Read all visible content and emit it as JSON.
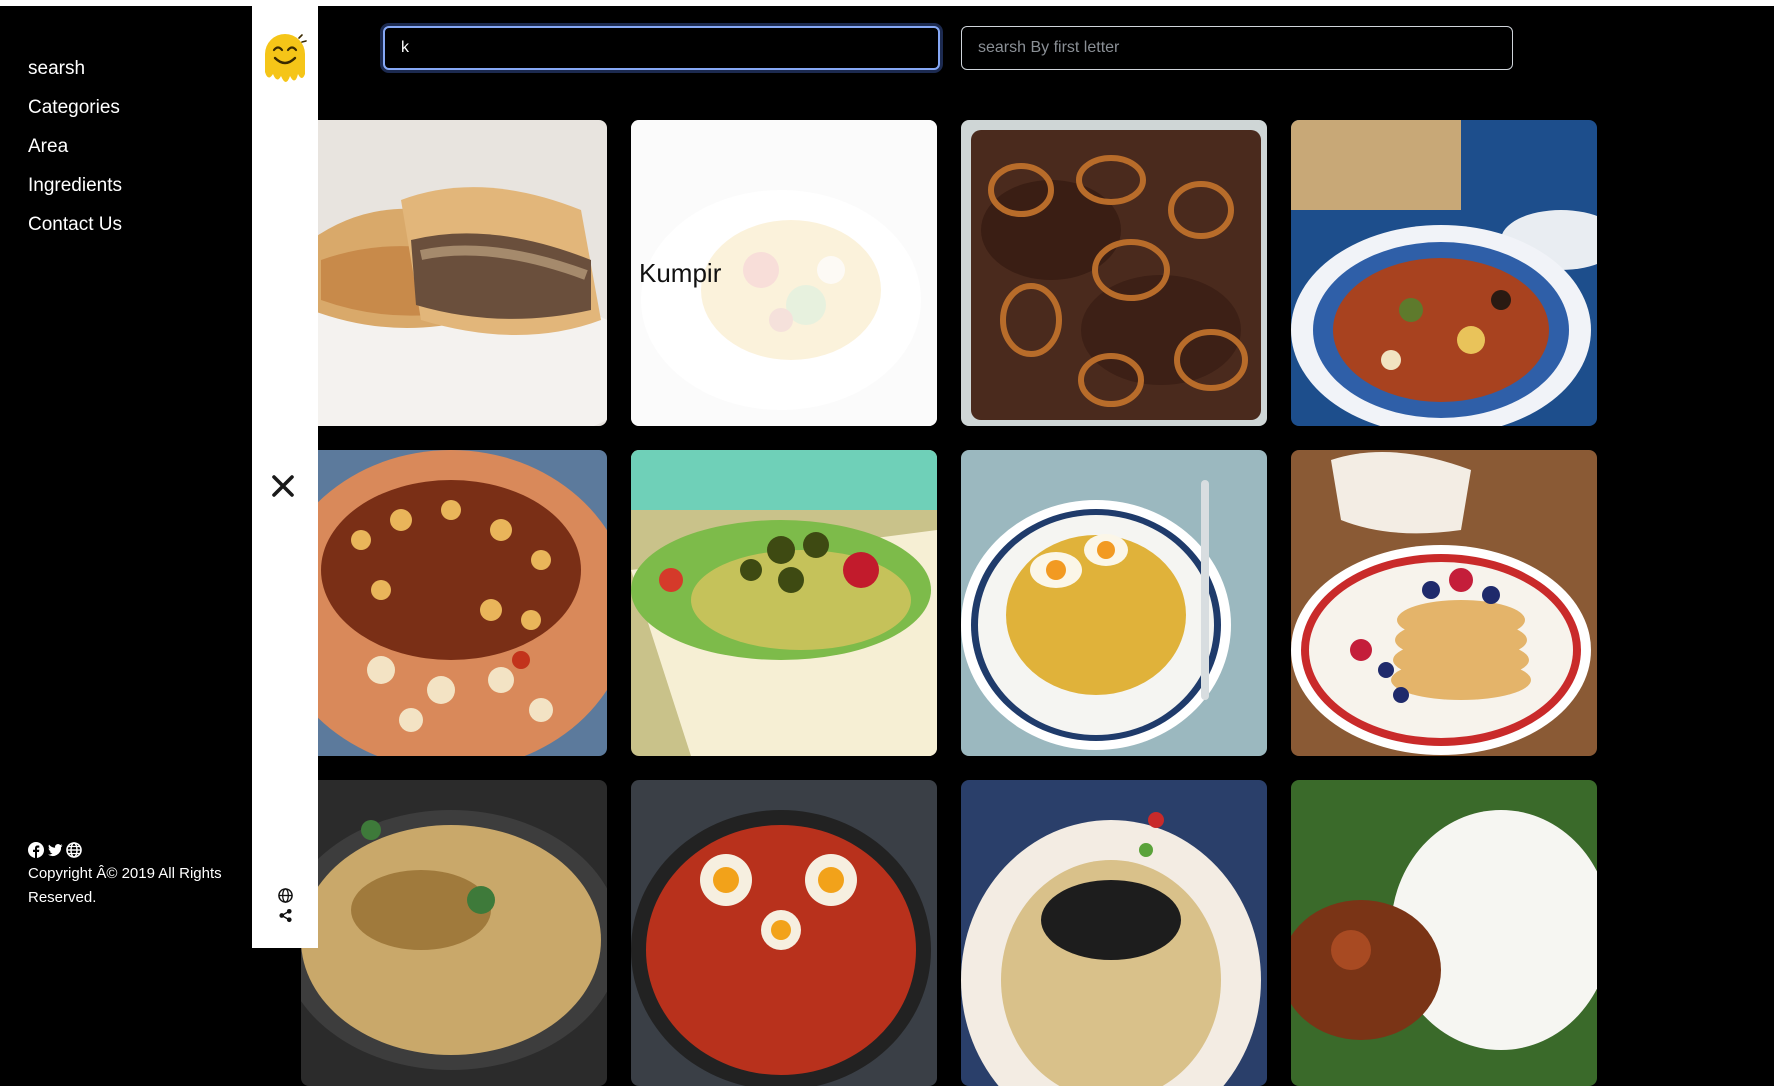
{
  "menu": {
    "items": [
      {
        "id": "search",
        "label": "searsh"
      },
      {
        "id": "categories",
        "label": "Categories"
      },
      {
        "id": "area",
        "label": "Area"
      },
      {
        "id": "ingredients",
        "label": "Ingredients"
      },
      {
        "id": "contact",
        "label": "Contact Us"
      }
    ],
    "social_icons": [
      "facebook-icon",
      "twitter-icon",
      "globe-icon"
    ],
    "copyright": "Copyright Â© 2019 All Rights Reserved."
  },
  "strip": {
    "logo_icon": "smiley-logo",
    "close_icon": "close-icon",
    "bottom_icons": [
      "globe-icon",
      "share-icon"
    ]
  },
  "search": {
    "name_value": "k",
    "name_placeholder": "",
    "letter_value": "",
    "letter_placeholder": "searsh By first letter"
  },
  "meals": [
    {
      "title": "",
      "hover": false
    },
    {
      "title": "Kumpir",
      "hover": true
    },
    {
      "title": "",
      "hover": false
    },
    {
      "title": "",
      "hover": false
    },
    {
      "title": "",
      "hover": false
    },
    {
      "title": "",
      "hover": false
    },
    {
      "title": "",
      "hover": false
    },
    {
      "title": "",
      "hover": false
    },
    {
      "title": "",
      "hover": false
    },
    {
      "title": "",
      "hover": false
    },
    {
      "title": "",
      "hover": false
    },
    {
      "title": "",
      "hover": false
    }
  ],
  "colors": {
    "background": "#000000",
    "strip": "#ffffff",
    "focus_ring": "#86a8f5",
    "logo_yellow": "#f5c518"
  }
}
